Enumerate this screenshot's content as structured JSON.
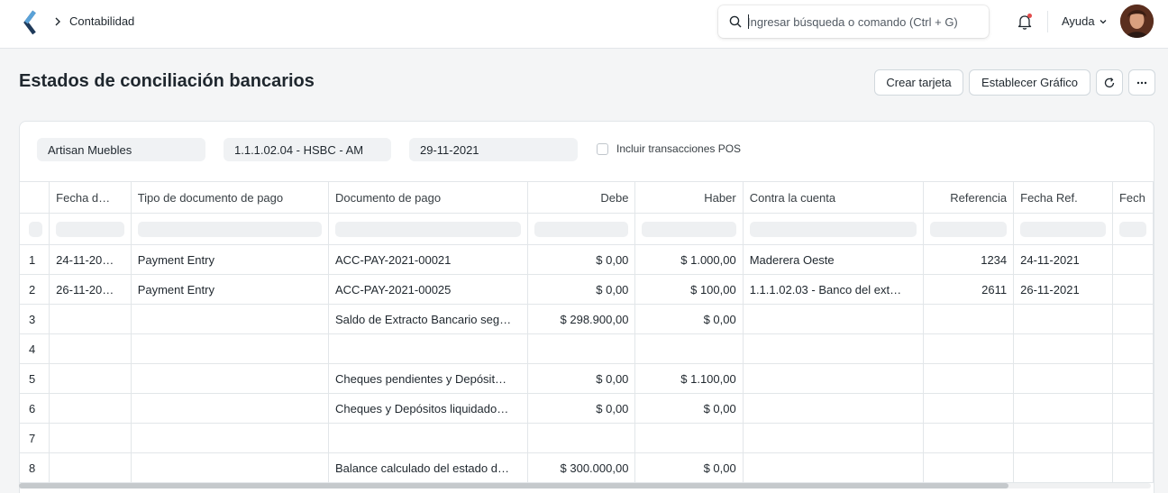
{
  "navbar": {
    "breadcrumb": "Contabilidad",
    "search_placeholder": "Ingresar búsqueda o comando (Ctrl + G)",
    "help_label": "Ayuda"
  },
  "page": {
    "title": "Estados de conciliación bancarios",
    "buttons": {
      "create_card": "Crear tarjeta",
      "set_chart": "Establecer Gráfico"
    }
  },
  "filters": {
    "company": "Artisan Muebles",
    "account": "1.1.1.02.04 - HSBC - AM",
    "date": "29-11-2021",
    "include_pos_label": "Incluir transacciones POS"
  },
  "table": {
    "columns": [
      "Fecha d…",
      "Tipo de documento de pago",
      "Documento de pago",
      "Debe",
      "Haber",
      "Contra la cuenta",
      "Referencia",
      "Fecha Ref.",
      "Fech"
    ],
    "rows": [
      [
        "1",
        "24-11-20…",
        "Payment Entry",
        "ACC-PAY-2021-00021",
        "$ 0,00",
        "$ 1.000,00",
        "Maderera Oeste",
        "1234",
        "24-11-2021",
        ""
      ],
      [
        "2",
        "26-11-20…",
        "Payment Entry",
        "ACC-PAY-2021-00025",
        "$ 0,00",
        "$ 100,00",
        "1.1.1.02.03 - Banco del ext…",
        "2611",
        "26-11-2021",
        ""
      ],
      [
        "3",
        "",
        "",
        "Saldo de Extracto Bancario seg…",
        "$ 298.900,00",
        "$ 0,00",
        "",
        "",
        "",
        ""
      ],
      [
        "4",
        "",
        "",
        "",
        "",
        "",
        "",
        "",
        "",
        ""
      ],
      [
        "5",
        "",
        "",
        "Cheques pendientes y Depósit…",
        "$ 0,00",
        "$ 1.100,00",
        "",
        "",
        "",
        ""
      ],
      [
        "6",
        "",
        "",
        "Cheques y Depósitos liquidado…",
        "$ 0,00",
        "$ 0,00",
        "",
        "",
        "",
        ""
      ],
      [
        "7",
        "",
        "",
        "",
        "",
        "",
        "",
        "",
        "",
        ""
      ],
      [
        "8",
        "",
        "",
        "Balance calculado del estado d…",
        "$ 300.000,00",
        "$ 0,00",
        "",
        "",
        "",
        ""
      ]
    ]
  },
  "icons": {
    "logo": "frappe-logo-icon",
    "search": "search-icon",
    "bell": "bell-icon",
    "refresh": "refresh-icon",
    "more": "more-icon"
  },
  "colors": {
    "notification_dot": "#e24c4c",
    "logo_dark": "#1f3a5a",
    "logo_light": "#5aa2d8"
  }
}
